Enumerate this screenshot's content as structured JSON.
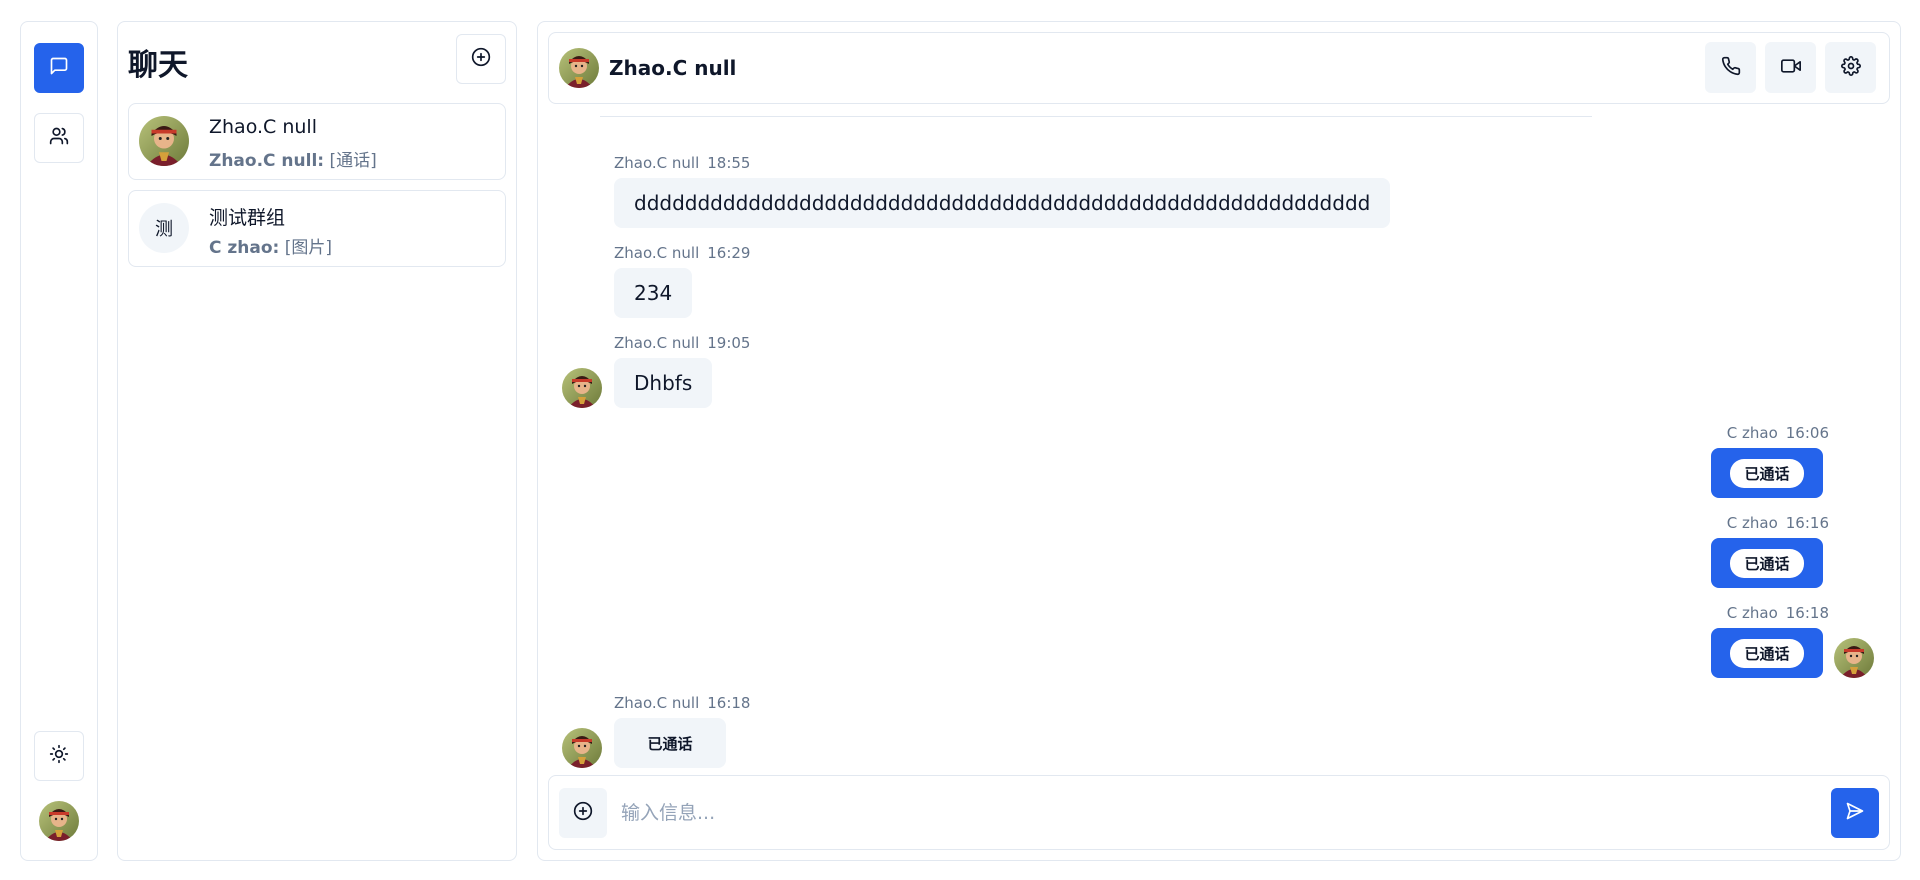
{
  "rail": {
    "chat_icon": "message-square-icon",
    "contacts_icon": "users-icon",
    "theme_icon": "sun-icon",
    "user_avatar": "user-avatar",
    "accent": "#2563eb"
  },
  "list": {
    "title": "聊天",
    "new_icon": "plus-circle-icon",
    "conversations": [
      {
        "name": "Zhao.C null",
        "sender": "Zhao.C null:",
        "preview": "[通话]",
        "avatar": "photo"
      },
      {
        "name": "测试群组",
        "sender": "C zhao:",
        "preview": "[图片]",
        "initial": "测"
      }
    ]
  },
  "chat": {
    "title": "Zhao.C null",
    "actions": [
      "phone-icon",
      "video-icon",
      "settings-icon"
    ],
    "messages": [
      {
        "sender": "Zhao.C null",
        "time": "18:55",
        "text": "dddddddddddddddddddddddddddddddddddddddddddddddddddddddddd",
        "dir": "in"
      },
      {
        "sender": "Zhao.C null",
        "time": "16:29",
        "text": "234",
        "dir": "in"
      },
      {
        "sender": "Zhao.C null",
        "time": "19:05",
        "text": "Dhbfs",
        "dir": "in"
      },
      {
        "sender": "C zhao",
        "time": "16:06",
        "text": "已通话",
        "dir": "out"
      },
      {
        "sender": "C zhao",
        "time": "16:16",
        "text": "已通话",
        "dir": "out"
      },
      {
        "sender": "C zhao",
        "time": "16:18",
        "text": "已通话",
        "dir": "out"
      },
      {
        "sender": "Zhao.C null",
        "time": "16:18",
        "text": "已通话",
        "dir": "in"
      }
    ]
  },
  "composer": {
    "placeholder": "输入信息...",
    "attach_icon": "plus-circle-icon",
    "send_icon": "send-icon"
  }
}
